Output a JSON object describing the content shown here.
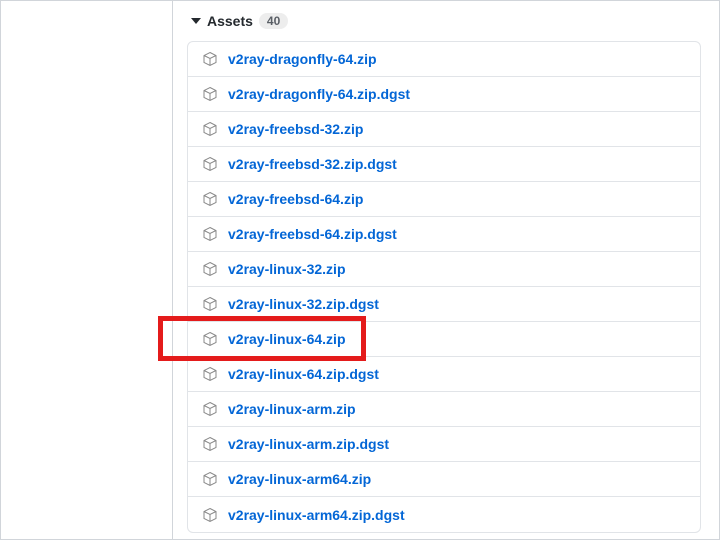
{
  "assets": {
    "header_label": "Assets",
    "count": "40",
    "items": [
      {
        "name": "v2ray-dragonfly-64.zip"
      },
      {
        "name": "v2ray-dragonfly-64.zip.dgst"
      },
      {
        "name": "v2ray-freebsd-32.zip"
      },
      {
        "name": "v2ray-freebsd-32.zip.dgst"
      },
      {
        "name": "v2ray-freebsd-64.zip"
      },
      {
        "name": "v2ray-freebsd-64.zip.dgst"
      },
      {
        "name": "v2ray-linux-32.zip"
      },
      {
        "name": "v2ray-linux-32.zip.dgst"
      },
      {
        "name": "v2ray-linux-64.zip"
      },
      {
        "name": "v2ray-linux-64.zip.dgst"
      },
      {
        "name": "v2ray-linux-arm.zip"
      },
      {
        "name": "v2ray-linux-arm.zip.dgst"
      },
      {
        "name": "v2ray-linux-arm64.zip"
      },
      {
        "name": "v2ray-linux-arm64.zip.dgst"
      }
    ],
    "highlighted_index": 8
  }
}
